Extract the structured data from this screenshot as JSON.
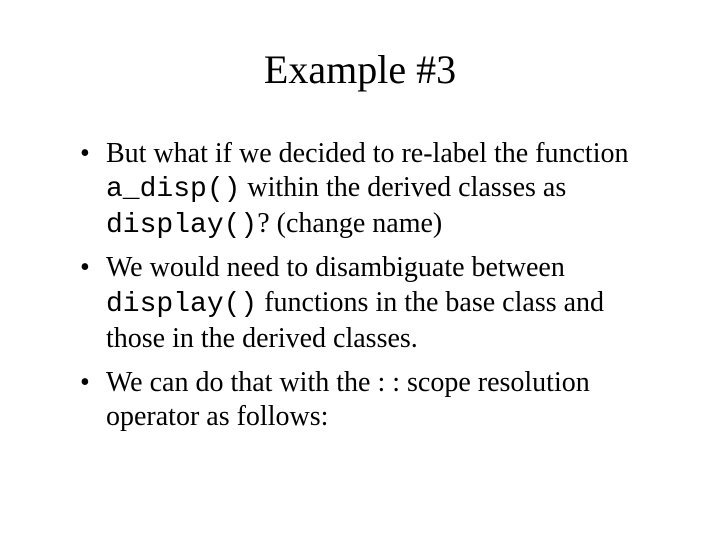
{
  "title": "Example #3",
  "bullets": [
    {
      "pre": "But what if we decided to re-label the function ",
      "code1": "a_disp()",
      "mid": " within the derived classes as ",
      "code2": "display()",
      "post": "? (change name)"
    },
    {
      "pre": "We would need to disambiguate between ",
      "code1": "display()",
      "mid": " functions in the base class and those in the derived classes.",
      "code2": "",
      "post": ""
    },
    {
      "pre": "We can do that with the : : scope resolution operator as follows:",
      "code1": "",
      "mid": "",
      "code2": "",
      "post": ""
    }
  ]
}
